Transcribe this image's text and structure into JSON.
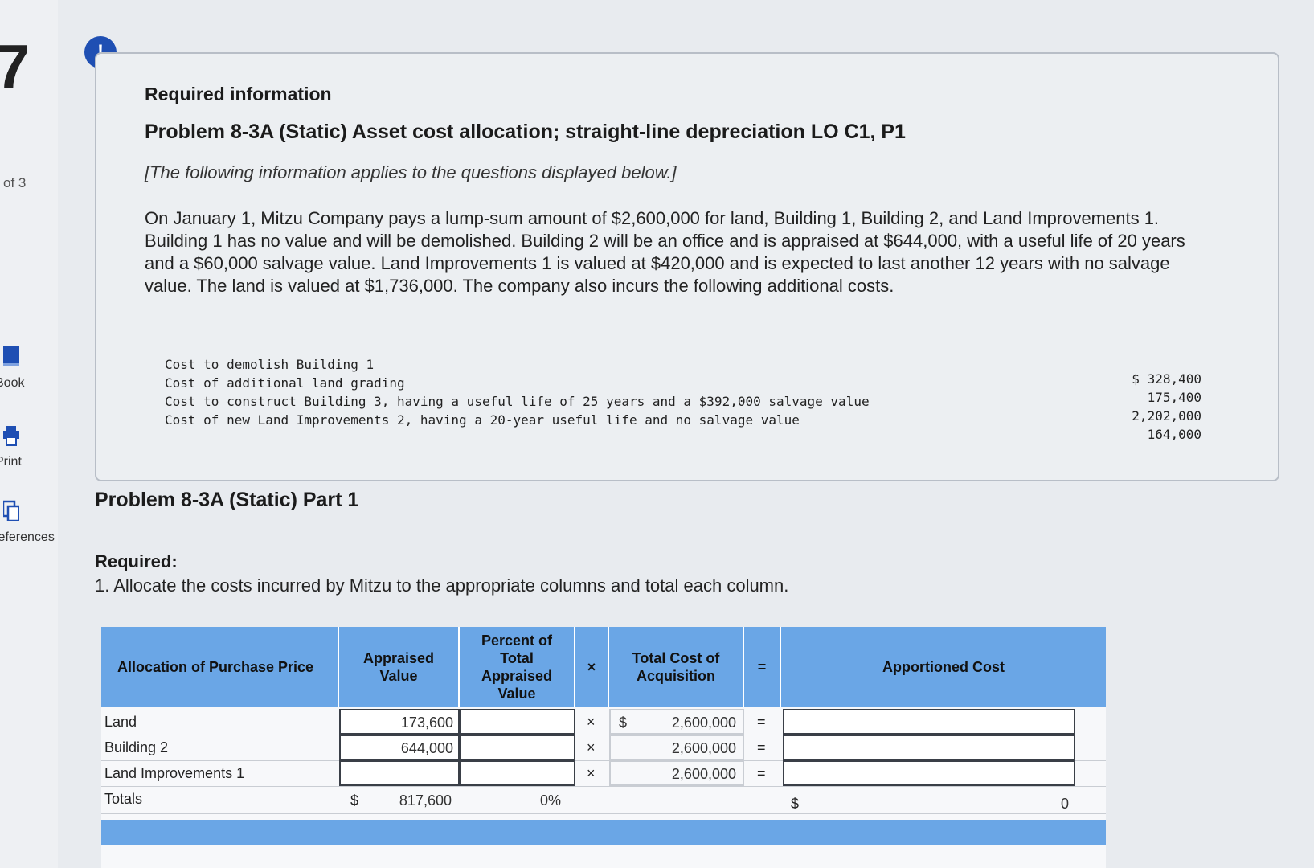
{
  "nav": {
    "question_number": "7",
    "of_label": "of 3",
    "items": [
      {
        "label": "Book",
        "icon": "book-icon"
      },
      {
        "label": "Print",
        "icon": "print-icon"
      },
      {
        "label": "References",
        "icon": "references-icon"
      }
    ]
  },
  "alert_icon": "!",
  "info": {
    "heading": "Required information",
    "problem_title": "Problem 8-3A (Static) Asset cost allocation; straight-line depreciation LO C1, P1",
    "note": "[The following information applies to the questions displayed below.]",
    "paragraph": "On January 1, Mitzu Company pays a lump-sum amount of $2,600,000 for land, Building 1, Building 2, and Land Improvements 1. Building 1 has no value and will be demolished. Building 2 will be an office and is appraised at $644,000, with a useful life of 20 years and a $60,000 salvage value. Land Improvements 1 is valued at $420,000 and is expected to last another 12 years with no salvage value. The land is valued at $1,736,000. The company also incurs the following additional costs.",
    "costs": [
      {
        "label": "Cost to demolish Building 1",
        "value": "$ 328,400"
      },
      {
        "label": "Cost of additional land grading",
        "value": "175,400"
      },
      {
        "label": "Cost to construct Building 3, having a useful life of 25 years and a $392,000 salvage value",
        "value": "2,202,000"
      },
      {
        "label": "Cost of new Land Improvements 2, having a 20-year useful life and no salvage value",
        "value": "164,000"
      }
    ]
  },
  "part": {
    "title": "Problem 8-3A (Static) Part 1",
    "required_label": "Required:",
    "instruction": "1. Allocate the costs incurred by Mitzu to the appropriate columns and total each column."
  },
  "table": {
    "headers": {
      "allocation": "Allocation of Purchase Price",
      "appraised": "Appraised Value",
      "percent": "Percent of Total Appraised Value",
      "times": "×",
      "total_cost": "Total Cost of Acquisition",
      "equals": "=",
      "apportioned": "Apportioned Cost"
    },
    "rows": [
      {
        "label": "Land",
        "dollar": "$",
        "appraised": "173,600",
        "percent": "",
        "times": "×",
        "cost_dollar": "$",
        "cost": "2,600,000",
        "equals": "=",
        "apportioned": ""
      },
      {
        "label": "Building 2",
        "dollar": "",
        "appraised": "644,000",
        "percent": "",
        "times": "×",
        "cost_dollar": "",
        "cost": "2,600,000",
        "equals": "=",
        "apportioned": ""
      },
      {
        "label": "Land Improvements 1",
        "dollar": "",
        "appraised": "",
        "percent": "",
        "times": "×",
        "cost_dollar": "",
        "cost": "2,600,000",
        "equals": "=",
        "apportioned": ""
      }
    ],
    "totals": {
      "label": "Totals",
      "dollar": "$",
      "appraised": "817,600",
      "percent": "0%",
      "apportioned_dollar": "$",
      "apportioned": "0"
    }
  }
}
